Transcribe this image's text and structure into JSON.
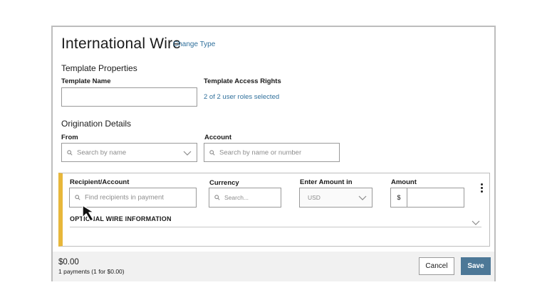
{
  "header": {
    "title": "International Wire",
    "change_type": "Change Type"
  },
  "template": {
    "section_title": "Template Properties",
    "name_label": "Template Name",
    "name_value": "",
    "access_label": "Template Access Rights",
    "access_link": "2 of 2 user roles selected"
  },
  "origination": {
    "section_title": "Origination Details",
    "from_label": "From",
    "from_placeholder": "Search by name",
    "account_label": "Account",
    "account_placeholder": "Search by name or number"
  },
  "payment": {
    "recipient_label": "Recipient/Account",
    "recipient_placeholder": "Find recipients in payment",
    "currency_label": "Currency",
    "currency_placeholder": "Search...",
    "enter_amount_label": "Enter Amount in",
    "enter_amount_value": "USD",
    "amount_label": "Amount",
    "amount_currency_sign": "$",
    "amount_value": "",
    "optional_section": "OPTIONAL WIRE INFORMATION",
    "accent_color": "#e8b73a"
  },
  "footer": {
    "total": "$0.00",
    "count": "1 payments (1 for $0.00)",
    "cancel_label": "Cancel",
    "save_label": "Save",
    "save_color": "#4d7897"
  },
  "icons": [
    "search-icon",
    "chevron-down-icon",
    "kebab-menu-icon",
    "mouse-cursor-icon"
  ]
}
